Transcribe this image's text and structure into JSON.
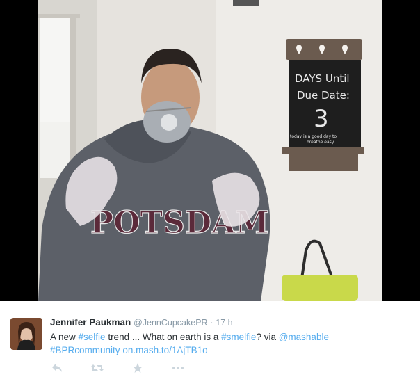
{
  "tweet": {
    "fullname": "Jennifer Paukman",
    "handle": "@JennCupcakePR",
    "separator": "·",
    "time": "17 h",
    "text_1": "A new ",
    "hashtag_selfie": "#selfie",
    "text_2": " trend ... What on earth is a ",
    "hashtag_smelfie": "#smelfie",
    "text_3": "? via ",
    "mention": "@mashable",
    "hashtag_community": "#BPRcommunity",
    "short_link": "on.mash.to/1AjTB1o"
  },
  "photo": {
    "chalkboard": {
      "line1": "DAYS Until",
      "line2": "Due Date:",
      "number": "3",
      "note1": "today is a good day to",
      "note2": "breathe easy"
    },
    "sweatshirt_text": "POTSDAM"
  },
  "actions": [
    "reply-icon",
    "retweet-icon",
    "favorite-icon",
    "more-icon"
  ],
  "colors": {
    "link": "#55acee",
    "name": "#292f33",
    "meta": "#8899a6",
    "icon": "#ccd6dd"
  }
}
